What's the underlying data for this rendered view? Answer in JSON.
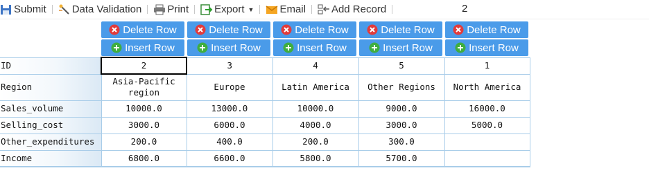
{
  "toolbar": {
    "submit": "Submit",
    "data_validation": "Data Validation",
    "print": "Print",
    "export": "Export",
    "email": "Email",
    "add_record": "Add Record",
    "page_number": "2"
  },
  "actions": {
    "delete_row": "Delete Row",
    "insert_row": "Insert Row"
  },
  "table": {
    "rows": [
      {
        "label": "ID",
        "cells": [
          "2",
          "3",
          "4",
          "5",
          "1"
        ]
      },
      {
        "label": "Region",
        "cells": [
          "Asia-Pacific region",
          "Europe",
          "Latin America",
          "Other Regions",
          "North America"
        ]
      },
      {
        "label": "Sales_volume",
        "cells": [
          "10000.0",
          "13000.0",
          "10000.0",
          "9000.0",
          "16000.0"
        ]
      },
      {
        "label": "Selling_cost",
        "cells": [
          "3000.0",
          "6000.0",
          "4000.0",
          "3000.0",
          "5000.0"
        ]
      },
      {
        "label": "Other_expenditures",
        "cells": [
          "200.0",
          "400.0",
          "200.0",
          "300.0",
          ""
        ]
      },
      {
        "label": "Income",
        "cells": [
          "6800.0",
          "6600.0",
          "5800.0",
          "5700.0",
          ""
        ]
      }
    ]
  },
  "icons": {
    "submit": "floppy-disk-icon",
    "data_validation": "wand-icon",
    "print": "printer-icon",
    "export": "export-icon",
    "email": "envelope-icon",
    "add_record": "add-record-icon",
    "delete": "red-x-circle-icon",
    "insert": "green-plus-circle-icon"
  },
  "colors": {
    "button_bg": "#4a9be9",
    "grid_border": "#a9cde9",
    "selected_border": "#000000"
  }
}
